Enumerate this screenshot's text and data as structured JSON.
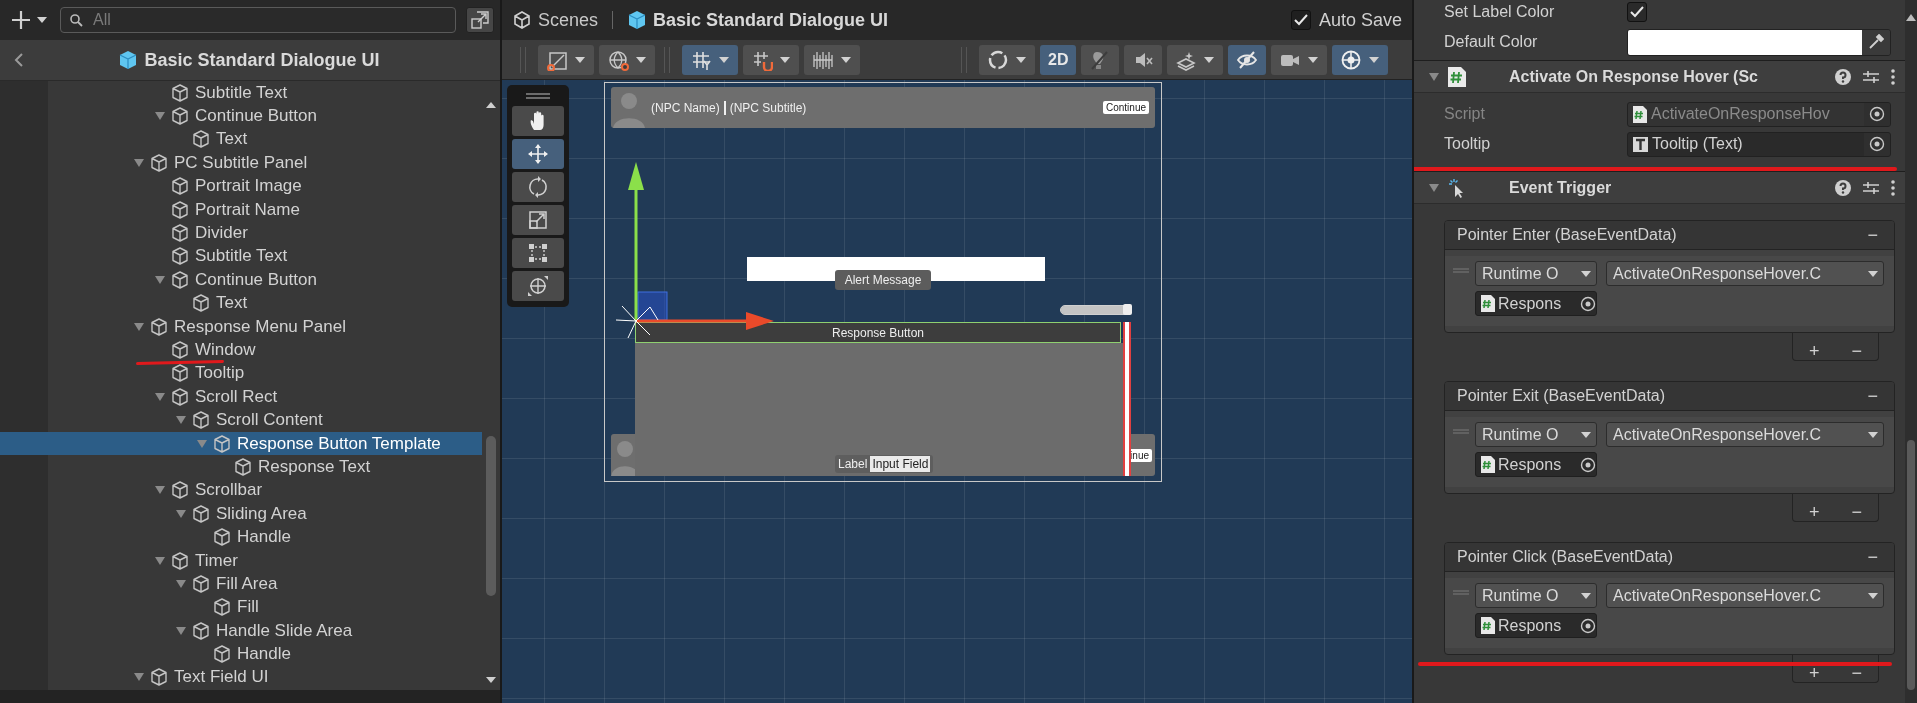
{
  "hierarchy": {
    "search": {
      "placeholder": "All"
    },
    "title": "Basic Standard Dialogue UI",
    "tree": {
      "partial_branch": {
        "children": [
          {
            "label": "Subtitle Text",
            "selected": false
          },
          {
            "label": "Continue Button",
            "selected": false,
            "expanded": true,
            "children": [
              {
                "label": "Text",
                "selected": false
              }
            ]
          }
        ]
      },
      "items": [
        {
          "label": "PC Subtitle Panel",
          "selected": false,
          "expanded": true,
          "children": [
            {
              "label": "Portrait Image",
              "selected": false
            },
            {
              "label": "Portrait Name",
              "selected": false
            },
            {
              "label": "Divider",
              "selected": false
            },
            {
              "label": "Subtitle Text",
              "selected": false
            },
            {
              "label": "Continue Button",
              "selected": false,
              "expanded": true,
              "children": [
                {
                  "label": "Text",
                  "selected": false
                }
              ]
            }
          ]
        },
        {
          "label": "Response Menu Panel",
          "selected": false,
          "expanded": true,
          "children": [
            {
              "label": "Window",
              "selected": false
            },
            {
              "label": "Tooltip",
              "selected": false
            },
            {
              "label": "Scroll Rect",
              "selected": false,
              "expanded": true,
              "children": [
                {
                  "label": "Scroll Content",
                  "selected": false,
                  "expanded": true,
                  "children": [
                    {
                      "label": "Response Button Template",
                      "selected": true,
                      "expanded": true,
                      "children": [
                        {
                          "label": "Response Text",
                          "selected": false
                        }
                      ]
                    }
                  ]
                }
              ]
            },
            {
              "label": "Scrollbar",
              "selected": false,
              "expanded": true,
              "children": [
                {
                  "label": "Sliding Area",
                  "selected": false,
                  "expanded": true,
                  "children": [
                    {
                      "label": "Handle",
                      "selected": false
                    }
                  ]
                }
              ]
            },
            {
              "label": "Timer",
              "selected": false,
              "expanded": true,
              "children": [
                {
                  "label": "Fill Area",
                  "selected": false,
                  "expanded": true,
                  "children": [
                    {
                      "label": "Fill",
                      "selected": false
                    }
                  ]
                },
                {
                  "label": "Handle Slide Area",
                  "selected": false,
                  "expanded": true,
                  "children": [
                    {
                      "label": "Handle",
                      "selected": false
                    }
                  ]
                }
              ]
            }
          ]
        },
        {
          "label": "Text Field UI",
          "selected": false,
          "expanded": true
        }
      ]
    }
  },
  "scene": {
    "tabs": {
      "root": "Scenes",
      "current": "Basic Standard Dialogue UI"
    },
    "auto_save": {
      "label": "Auto Save",
      "checked": true
    },
    "toolbar": {
      "groups": [
        [
          {
            "on": false,
            "dropdown": true
          },
          {
            "on": false,
            "dropdown": true
          }
        ],
        [
          {
            "on": true,
            "dropdown": true
          },
          {
            "on": false,
            "dropdown": true
          },
          {
            "on": false,
            "dropdown": true
          }
        ],
        [
          {
            "on": false,
            "dropdown": true
          },
          {
            "label": "2D",
            "on": true,
            "dropdown": false
          },
          {
            "on": false,
            "dropdown": false
          },
          {
            "on": false,
            "dropdown": false
          },
          {
            "on": false,
            "dropdown": true
          },
          {
            "on": true,
            "dropdown": false
          },
          {
            "on": false,
            "dropdown": true
          },
          {
            "on": true,
            "dropdown": true
          }
        ]
      ]
    },
    "tools": [
      {
        "selected": false
      },
      {
        "selected": true
      },
      {
        "selected": false
      },
      {
        "selected": false
      },
      {
        "selected": false
      },
      {
        "selected": false
      }
    ],
    "canvas": {
      "npc_panel": {
        "name": "(NPC Name)",
        "subtitle": "(NPC Subtitle)",
        "continue": "Continue"
      },
      "alert": "Alert Message",
      "timer": {
        "level": 0.95
      },
      "response_button": "Response Button",
      "pc_panel": {
        "continue": "inue"
      },
      "input": {
        "label": "Label",
        "field": "Input Field"
      }
    }
  },
  "inspector": {
    "top_rows": [
      {
        "kind": "checkbox",
        "label": "Set Label Color",
        "checked": true
      },
      {
        "kind": "color",
        "label": "Default Color"
      }
    ],
    "script_component": {
      "title": "Activate On Response Hover (Sc",
      "expanded": true,
      "fields": [
        {
          "kind": "script",
          "label": "Script",
          "value": "ActivateOnResponseHov",
          "disabled": true
        },
        {
          "kind": "text",
          "label": "Tooltip",
          "value": "Tooltip (Text)",
          "disabled": false
        }
      ]
    },
    "event_trigger": {
      "title": "Event Trigger",
      "expanded": true,
      "events": [
        {
          "title": "Pointer Enter (BaseEventData)",
          "remove": "−",
          "mode": "Runtime O",
          "function": "ActivateOnResponseHover.C",
          "object": "Respons",
          "add": "+",
          "remove_entry": "−"
        },
        {
          "title": "Pointer Exit (BaseEventData)",
          "remove": "−",
          "mode": "Runtime O",
          "function": "ActivateOnResponseHover.C",
          "object": "Respons",
          "add": "+",
          "remove_entry": "−"
        },
        {
          "title": "Pointer Click (BaseEventData)",
          "remove": "−",
          "mode": "Runtime O",
          "function": "ActivateOnResponseHover.C",
          "object": "Respons",
          "add": "+",
          "remove_entry": "−"
        }
      ]
    }
  }
}
